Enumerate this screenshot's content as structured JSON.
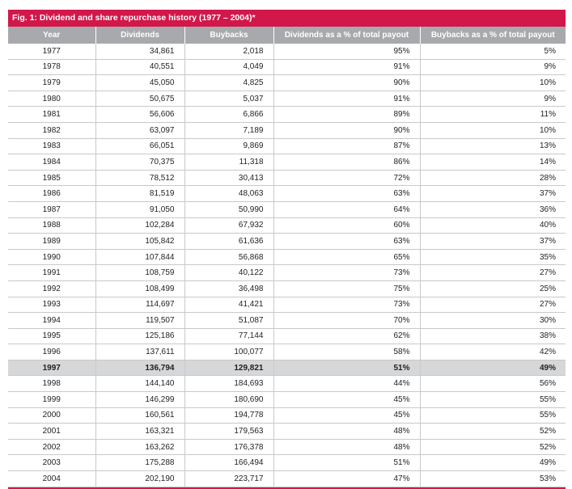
{
  "title": "Fig. 1: Dividend and share repurchase history (1977 – 2004)*",
  "columns": [
    "Year",
    "Dividends",
    "Buybacks",
    "Dividends as a % of total payout",
    "Buybacks as a % of total payout"
  ],
  "highlight_row": 20,
  "colors": {
    "accent": "#d2174a",
    "header_bg": "#a8a9ad",
    "highlight_bg": "#d6d7d9"
  },
  "rows": [
    [
      "1977",
      "34,861",
      "2,018",
      "95%",
      "5%"
    ],
    [
      "1978",
      "40,551",
      "4,049",
      "91%",
      "9%"
    ],
    [
      "1979",
      "45,050",
      "4,825",
      "90%",
      "10%"
    ],
    [
      "1980",
      "50,675",
      "5,037",
      "91%",
      "9%"
    ],
    [
      "1981",
      "56,606",
      "6,866",
      "89%",
      "11%"
    ],
    [
      "1982",
      "63,097",
      "7,189",
      "90%",
      "10%"
    ],
    [
      "1983",
      "66,051",
      "9,869",
      "87%",
      "13%"
    ],
    [
      "1984",
      "70,375",
      "11,318",
      "86%",
      "14%"
    ],
    [
      "1985",
      "78,512",
      "30,413",
      "72%",
      "28%"
    ],
    [
      "1986",
      "81,519",
      "48,063",
      "63%",
      "37%"
    ],
    [
      "1987",
      "91,050",
      "50,990",
      "64%",
      "36%"
    ],
    [
      "1988",
      "102,284",
      "67,932",
      "60%",
      "40%"
    ],
    [
      "1989",
      "105,842",
      "61,636",
      "63%",
      "37%"
    ],
    [
      "1990",
      "107,844",
      "56,868",
      "65%",
      "35%"
    ],
    [
      "1991",
      "108,759",
      "40,122",
      "73%",
      "27%"
    ],
    [
      "1992",
      "108,499",
      "36,498",
      "75%",
      "25%"
    ],
    [
      "1993",
      "114,697",
      "41,421",
      "73%",
      "27%"
    ],
    [
      "1994",
      "119,507",
      "51,087",
      "70%",
      "30%"
    ],
    [
      "1995",
      "125,186",
      "77,144",
      "62%",
      "38%"
    ],
    [
      "1996",
      "137,611",
      "100,077",
      "58%",
      "42%"
    ],
    [
      "1997",
      "136,794",
      "129,821",
      "51%",
      "49%"
    ],
    [
      "1998",
      "144,140",
      "184,693",
      "44%",
      "56%"
    ],
    [
      "1999",
      "146,299",
      "180,690",
      "45%",
      "55%"
    ],
    [
      "2000",
      "160,561",
      "194,778",
      "45%",
      "55%"
    ],
    [
      "2001",
      "163,321",
      "179,563",
      "48%",
      "52%"
    ],
    [
      "2002",
      "163,262",
      "176,378",
      "48%",
      "52%"
    ],
    [
      "2003",
      "175,288",
      "166,494",
      "51%",
      "49%"
    ],
    [
      "2004",
      "202,190",
      "223,717",
      "47%",
      "53%"
    ]
  ]
}
